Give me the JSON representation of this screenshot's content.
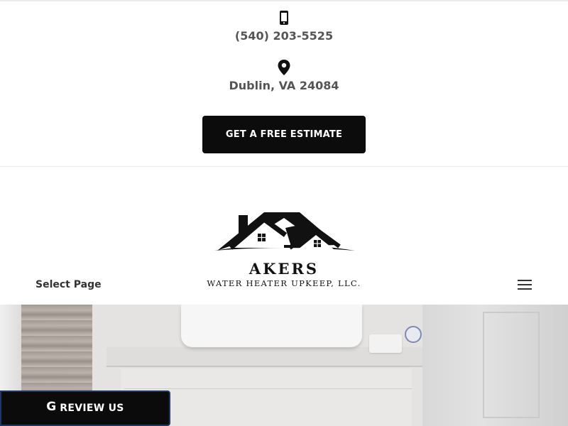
{
  "topbar": {
    "phone": "(540) 203-5525",
    "address": "Dublin, VA 24084",
    "cta_label": "GET A FREE ESTIMATE",
    "icons": {
      "phone": "mobile-phone-icon",
      "location": "map-pin-icon"
    }
  },
  "header": {
    "logo_title": "AKERS",
    "logo_subtitle": "WATER HEATER UPKEEP, LLC.",
    "select_page": "Select Page",
    "menu_icon": "hamburger-menu-icon"
  },
  "review": {
    "icon_letter": "G",
    "label": "REVIEW US"
  },
  "colors": {
    "button_bg": "#0c0c0c",
    "contact_text": "#555555",
    "review_border": "#1e3766"
  }
}
